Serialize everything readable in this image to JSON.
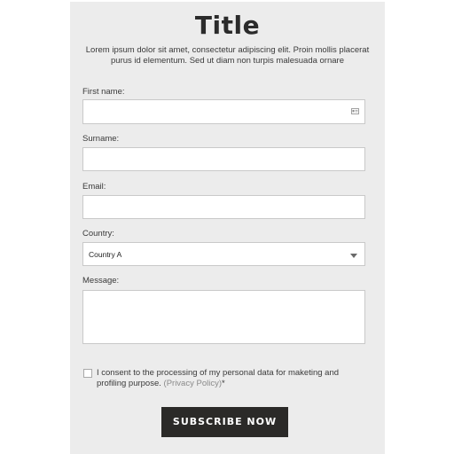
{
  "form": {
    "title": "Title",
    "intro": "Lorem ipsum dolor sit amet, consectetur adipiscing elit. Proin mollis placerat purus id elementum. Sed ut diam non turpis malesuada ornare",
    "fields": {
      "first_name": {
        "label": "First name:",
        "value": "",
        "icon": "contact-card-icon"
      },
      "surname": {
        "label": "Surname:",
        "value": ""
      },
      "email": {
        "label": "Email:",
        "value": ""
      },
      "country": {
        "label": "Country:",
        "selected": "Country A",
        "icon": "chevron-down-icon"
      },
      "message": {
        "label": "Message:",
        "value": ""
      }
    },
    "consent": {
      "checked": false,
      "text": "I consent to the processing of my personal data for maketing and profiling purpose.",
      "link": "(Privacy Policy)",
      "suffix": "*"
    },
    "submit_label": "SUBSCRIBE NOW"
  },
  "colors": {
    "card_background": "#ececec",
    "button_background": "#2b2a28",
    "button_text": "#ffffff",
    "text": "#2b2b2b",
    "link": "#8a8a8a"
  }
}
